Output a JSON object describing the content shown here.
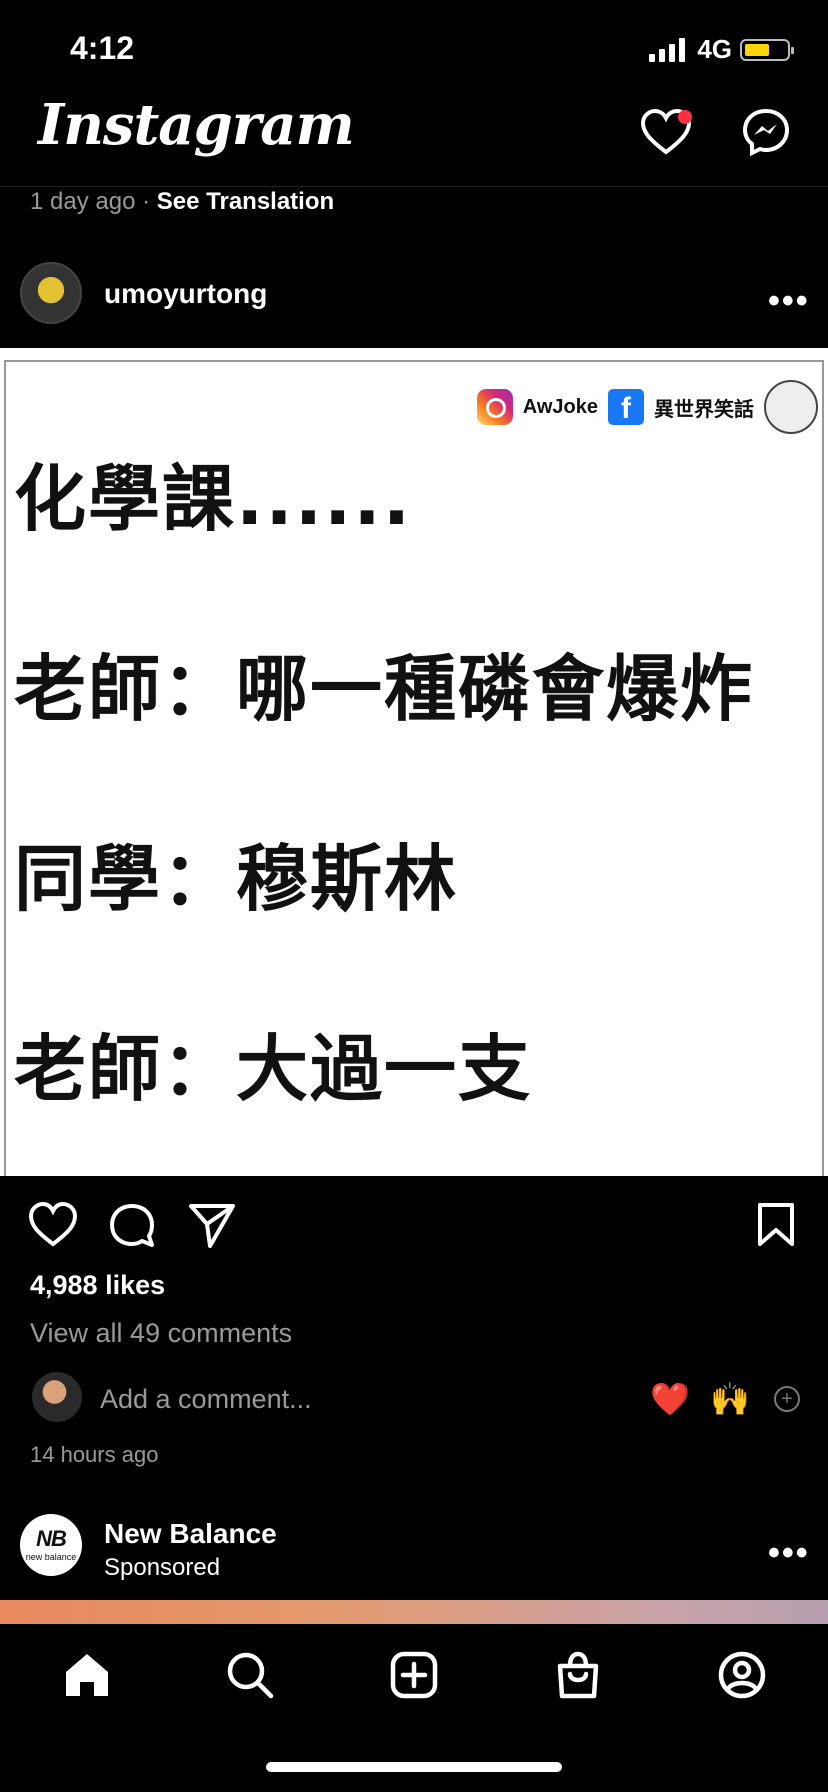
{
  "status_bar": {
    "time": "4:12",
    "network": "4G"
  },
  "header": {
    "logo": "Instagram"
  },
  "previous_post": {
    "age": "1 day ago",
    "separator": "·",
    "see_translation": "See Translation"
  },
  "post": {
    "username": "umoyurtong",
    "image": {
      "watermark_ig": "AwJoke",
      "watermark_fb": "異世界笑話",
      "lines": [
        "化學課......",
        "老師：哪一種磷會爆炸",
        "同學：穆斯林",
        "老師：大過一支"
      ]
    },
    "likes": "4,988 likes",
    "view_all_comments": "View all 49 comments",
    "add_comment_placeholder": "Add a comment...",
    "quick_emojis": [
      "❤️",
      "🙌"
    ],
    "time": "14 hours ago"
  },
  "sponsored_post": {
    "brand": "New Balance",
    "label": "Sponsored",
    "avatar_text": "NB",
    "avatar_sub": "new balance"
  },
  "colors": {
    "notification_dot": "#ff3040",
    "battery": "#ffd60a"
  },
  "icons": [
    "signal-icon",
    "battery-icon",
    "heart-icon",
    "messenger-icon",
    "more-icon",
    "comment-icon",
    "share-icon",
    "bookmark-icon",
    "add-icon",
    "home-icon",
    "search-icon",
    "create-icon",
    "shop-icon",
    "profile-icon"
  ]
}
